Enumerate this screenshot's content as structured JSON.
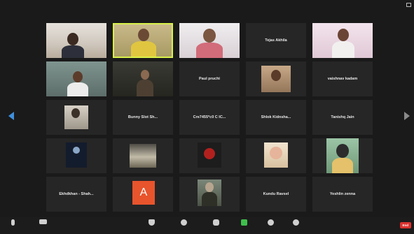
{
  "participants": [
    {
      "name": "",
      "label": "",
      "video": true
    },
    {
      "name": "",
      "label": "",
      "video": true,
      "active": true
    },
    {
      "name": "",
      "label": "",
      "video": true
    },
    {
      "name": "Tejas Akhila",
      "label": ""
    },
    {
      "name": "",
      "label": "",
      "video": true
    },
    {
      "name": "",
      "label": "",
      "video": true
    },
    {
      "name": "",
      "label": "",
      "video": true
    },
    {
      "name": "Paul pruchi",
      "label": ""
    },
    {
      "name": "",
      "label": "",
      "video": true
    },
    {
      "name": "vaishnav kadam",
      "label": ""
    },
    {
      "name": "",
      "label": "",
      "video": true
    },
    {
      "name": "Bunny Slot Sh...",
      "label": ""
    },
    {
      "name": "Cre7455*c0 C IC...",
      "label": ""
    },
    {
      "name": "Shlok Kidnsha...",
      "label": ""
    },
    {
      "name": "Tanishq Jain",
      "label": ""
    },
    {
      "name": "",
      "label": "",
      "video": true
    },
    {
      "name": "",
      "label": "",
      "video": true
    },
    {
      "name": "",
      "label": "",
      "video": true
    },
    {
      "name": "",
      "label": "",
      "video": true
    },
    {
      "name": "",
      "label": "",
      "video": true
    },
    {
      "name": "Ekhdkhan - Shah...",
      "label": ""
    },
    {
      "name": "",
      "label": "",
      "avatar": "A"
    },
    {
      "name": "",
      "label": "",
      "video": true
    },
    {
      "name": "Kundu Ravsel",
      "label": ""
    },
    {
      "name": "Yeshlin zenna",
      "label": ""
    }
  ],
  "toolbar": {
    "end": "End"
  },
  "colors": {
    "active_border": "#d9f24a",
    "avatar_bg": "#e8542c",
    "end_button": "#d9322f",
    "nav_arrow": "#3f8fdc"
  }
}
